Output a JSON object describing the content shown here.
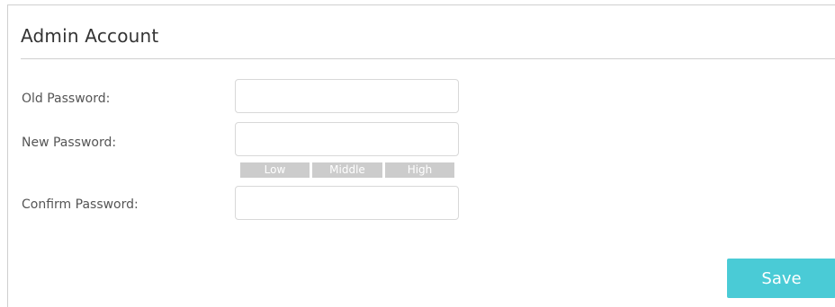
{
  "section": {
    "title": "Admin Account"
  },
  "form": {
    "old_password": {
      "label": "Old Password:",
      "value": ""
    },
    "new_password": {
      "label": "New Password:",
      "value": ""
    },
    "strength": {
      "low": "Low",
      "middle": "Middle",
      "high": "High"
    },
    "confirm_password": {
      "label": "Confirm Password:",
      "value": ""
    }
  },
  "actions": {
    "save_label": "Save"
  },
  "colors": {
    "accent": "#4acbd6",
    "strength_inactive": "#cccccc",
    "border": "#d8d8d8"
  }
}
